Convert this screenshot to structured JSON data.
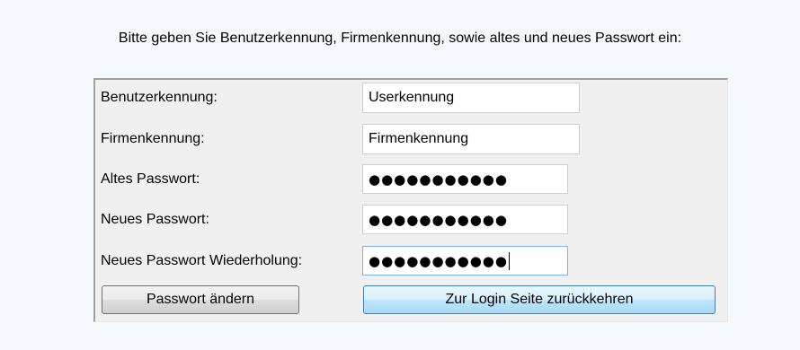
{
  "instruction": "Bitte geben Sie Benutzerkennung, Firmenkennung, sowie altes und neues Passwort ein:",
  "form": {
    "user_label": "Benutzerkennung:",
    "user_value": "Userkennung",
    "company_label": "Firmenkennung:",
    "company_value": "Firmenkennung",
    "old_pw_label": "Altes Passwort:",
    "old_pw_value": "●●●●●●●●●●●",
    "new_pw_label": "Neues Passwort:",
    "new_pw_value": "●●●●●●●●●●●",
    "repeat_pw_label": "Neues Passwort Wiederholung:",
    "repeat_pw_value": "●●●●●●●●●●●"
  },
  "buttons": {
    "change_password": "Passwort ändern",
    "back_to_login": "Zur Login Seite zurückkehren"
  },
  "colors": {
    "page_background": "#f5f8fd",
    "panel_background": "#f0f0f0",
    "focus_border": "#7eb4ea",
    "hover_button_border": "#3c7fb1"
  }
}
